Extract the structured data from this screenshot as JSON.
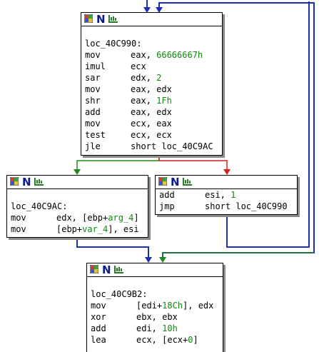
{
  "colors": {
    "edge_unconditional": "#1c2fb5",
    "edge_true": "#1f8a1f",
    "edge_false": "#d81e1e",
    "immediate_value": "#0a8a0a",
    "node_shadow": "#8a8a8a"
  },
  "header_icons": [
    "graph-grid-icon",
    "n-letter-icon",
    "label-icon"
  ],
  "header_n_glyph": "N",
  "nodes": {
    "loc_40C990": {
      "label": "loc_40C990:",
      "lines": [
        {
          "mnemonic": "mov",
          "ops": [
            {
              "t": "eax, "
            },
            {
              "t": "66666667h",
              "c": "num"
            }
          ]
        },
        {
          "mnemonic": "imul",
          "ops": [
            {
              "t": "ecx"
            }
          ]
        },
        {
          "mnemonic": "sar",
          "ops": [
            {
              "t": "edx, "
            },
            {
              "t": "2",
              "c": "num"
            }
          ]
        },
        {
          "mnemonic": "mov",
          "ops": [
            {
              "t": "eax, edx"
            }
          ]
        },
        {
          "mnemonic": "shr",
          "ops": [
            {
              "t": "eax, "
            },
            {
              "t": "1Fh",
              "c": "num"
            }
          ]
        },
        {
          "mnemonic": "add",
          "ops": [
            {
              "t": "eax, edx"
            }
          ]
        },
        {
          "mnemonic": "mov",
          "ops": [
            {
              "t": "ecx, eax"
            }
          ]
        },
        {
          "mnemonic": "test",
          "ops": [
            {
              "t": "ecx, ecx"
            }
          ]
        },
        {
          "mnemonic": "jle",
          "ops": [
            {
              "t": "short loc_40C9AC"
            }
          ]
        }
      ]
    },
    "loc_40C9AC": {
      "label": "loc_40C9AC:",
      "lines": [
        {
          "mnemonic": "mov",
          "ops": [
            {
              "t": "edx, [ebp+"
            },
            {
              "t": "arg_4",
              "c": "var"
            },
            {
              "t": "]"
            }
          ]
        },
        {
          "mnemonic": "mov",
          "ops": [
            {
              "t": "[ebp+"
            },
            {
              "t": "var_4",
              "c": "var"
            },
            {
              "t": "], esi"
            }
          ]
        }
      ]
    },
    "add_block": {
      "label": "",
      "lines": [
        {
          "mnemonic": "add",
          "ops": [
            {
              "t": "esi, "
            },
            {
              "t": "1",
              "c": "num"
            }
          ]
        },
        {
          "mnemonic": "jmp",
          "ops": [
            {
              "t": "short loc_40C990"
            }
          ]
        }
      ]
    },
    "loc_40C9B2": {
      "label": "loc_40C9B2:",
      "lines": [
        {
          "mnemonic": "mov",
          "ops": [
            {
              "t": "[edi+"
            },
            {
              "t": "18Ch",
              "c": "num"
            },
            {
              "t": "], edx"
            }
          ]
        },
        {
          "mnemonic": "xor",
          "ops": [
            {
              "t": "ebx, ebx"
            }
          ]
        },
        {
          "mnemonic": "add",
          "ops": [
            {
              "t": "edi, "
            },
            {
              "t": "10h",
              "c": "num"
            }
          ]
        },
        {
          "mnemonic": "lea",
          "ops": [
            {
              "t": "ecx, [ecx+"
            },
            {
              "t": "0",
              "c": "num"
            },
            {
              "t": "]"
            }
          ]
        }
      ]
    }
  }
}
